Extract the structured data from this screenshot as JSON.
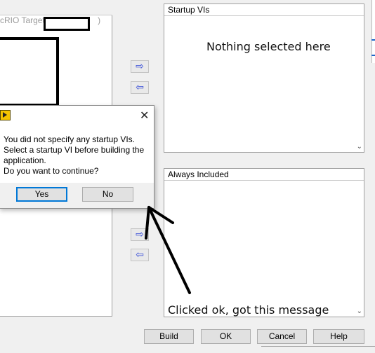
{
  "left_panel": {
    "target_label": "cRIO Target (",
    "target_suffix": ")"
  },
  "startup": {
    "header": "Startup VIs",
    "annotation": "Nothing selected here"
  },
  "always": {
    "header": "Always Included",
    "annotation": "Clicked ok, got this message"
  },
  "arrows": {
    "right": "⇨",
    "left": "⇦"
  },
  "dialog": {
    "close_glyph": "✕",
    "line1": "You did not specify any startup VIs.",
    "line2": "Select a startup VI before building the application.",
    "line3": "Do you want to continue?",
    "yes_label": "Yes",
    "no_label": "No"
  },
  "footer": {
    "build_label": "Build",
    "ok_label": "OK",
    "cancel_label": "Cancel",
    "help_label": "Help"
  },
  "scroll": {
    "down_glyph": "⌄"
  },
  "colors": {
    "arrow_blue": "#3a4fd8",
    "default_button_border": "#0078d7",
    "dialog_icon": "#f5c400"
  }
}
